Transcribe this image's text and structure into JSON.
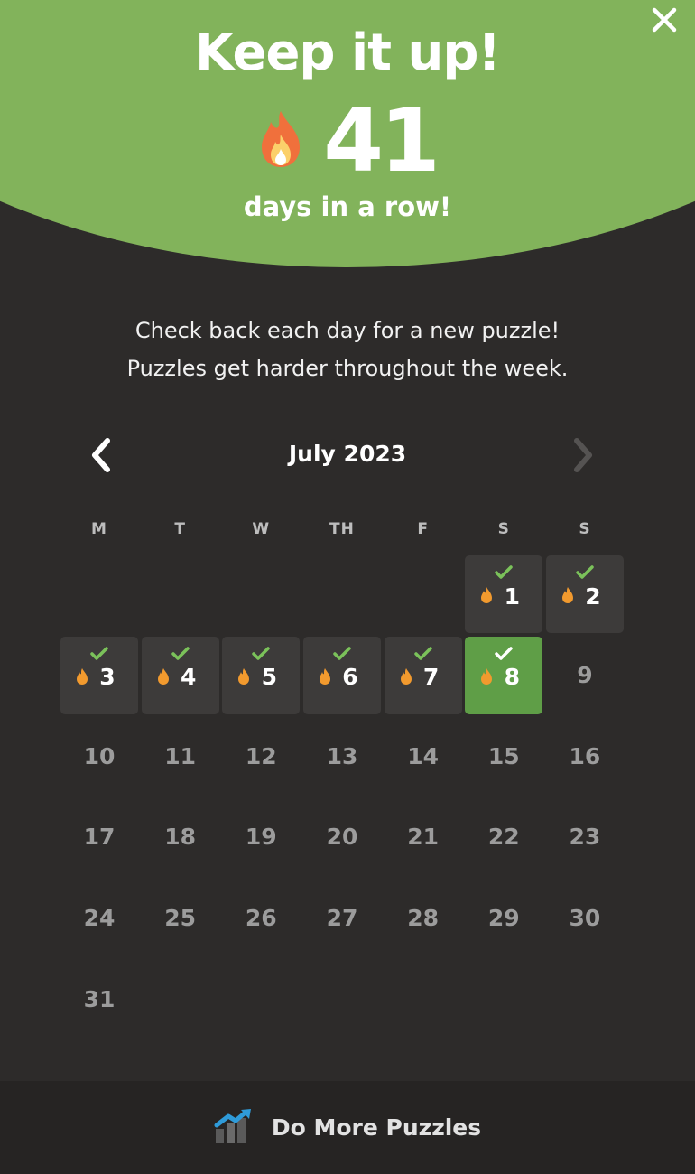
{
  "hero": {
    "title": "Keep it up!",
    "streak_count": "41",
    "streak_caption": "days in a row!"
  },
  "info": {
    "line1": "Check back each day for a new puzzle!",
    "line2": "Puzzles get harder throughout the week."
  },
  "calendar": {
    "month_label": "July 2023",
    "weekdays": [
      "M",
      "T",
      "W",
      "TH",
      "F",
      "S",
      "S"
    ],
    "leading_empty_days": 5,
    "days": [
      {
        "n": "1",
        "state": "done"
      },
      {
        "n": "2",
        "state": "done"
      },
      {
        "n": "3",
        "state": "done"
      },
      {
        "n": "4",
        "state": "done"
      },
      {
        "n": "5",
        "state": "done"
      },
      {
        "n": "6",
        "state": "done"
      },
      {
        "n": "7",
        "state": "done"
      },
      {
        "n": "8",
        "state": "today"
      },
      {
        "n": "9",
        "state": "future"
      },
      {
        "n": "10",
        "state": "future"
      },
      {
        "n": "11",
        "state": "future"
      },
      {
        "n": "12",
        "state": "future"
      },
      {
        "n": "13",
        "state": "future"
      },
      {
        "n": "14",
        "state": "future"
      },
      {
        "n": "15",
        "state": "future"
      },
      {
        "n": "16",
        "state": "future"
      },
      {
        "n": "17",
        "state": "future"
      },
      {
        "n": "18",
        "state": "future"
      },
      {
        "n": "19",
        "state": "future"
      },
      {
        "n": "20",
        "state": "future"
      },
      {
        "n": "21",
        "state": "future"
      },
      {
        "n": "22",
        "state": "future"
      },
      {
        "n": "23",
        "state": "future"
      },
      {
        "n": "24",
        "state": "future"
      },
      {
        "n": "25",
        "state": "future"
      },
      {
        "n": "26",
        "state": "future"
      },
      {
        "n": "27",
        "state": "future"
      },
      {
        "n": "28",
        "state": "future"
      },
      {
        "n": "29",
        "state": "future"
      },
      {
        "n": "30",
        "state": "future"
      },
      {
        "n": "31",
        "state": "future"
      }
    ]
  },
  "footer": {
    "label": "Do More Puzzles",
    "icon": "chart-growth-icon"
  },
  "icons": {
    "close": "close-icon",
    "prev": "chevron-left-icon",
    "next": "chevron-right-icon",
    "flame": "flame-icon",
    "check": "check-icon"
  },
  "colors": {
    "accent_green": "#82b35b",
    "today_green": "#5f9e47",
    "check_green": "#7bc25a",
    "flame_orange": "#f29a2e",
    "background": "#2d2b2a"
  }
}
